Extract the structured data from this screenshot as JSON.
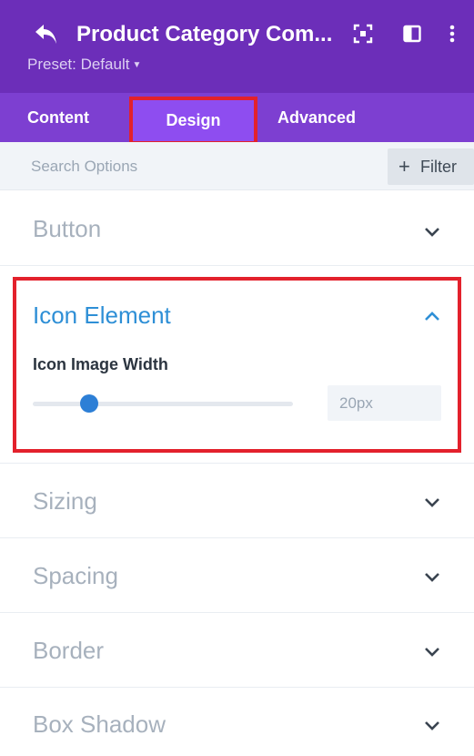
{
  "header": {
    "title": "Product Category Com...",
    "preset": "Preset: Default",
    "bg_color": "#6c2eb9",
    "icons": [
      "back-arrow-icon",
      "focus-icon",
      "split-view-icon",
      "more-vert-icon"
    ]
  },
  "tabs": [
    {
      "label": "Content",
      "active": false
    },
    {
      "label": "Design",
      "active": true
    },
    {
      "label": "Advanced",
      "active": false
    }
  ],
  "search": {
    "placeholder": "Search Options",
    "value": "",
    "filter_label": "Filter"
  },
  "sections": {
    "button": {
      "label": "Button",
      "expanded": false
    },
    "icon_element": {
      "label": "Icon Element",
      "expanded": true,
      "setting_label": "Icon Image Width",
      "slider_value": "20px",
      "accent_color": "#2e8fd6"
    },
    "sizing": {
      "label": "Sizing",
      "expanded": false
    },
    "spacing": {
      "label": "Spacing",
      "expanded": false
    },
    "border": {
      "label": "Border",
      "expanded": false
    },
    "box_shadow": {
      "label": "Box Shadow",
      "expanded": false
    }
  },
  "highlight_color": "#e3212c"
}
